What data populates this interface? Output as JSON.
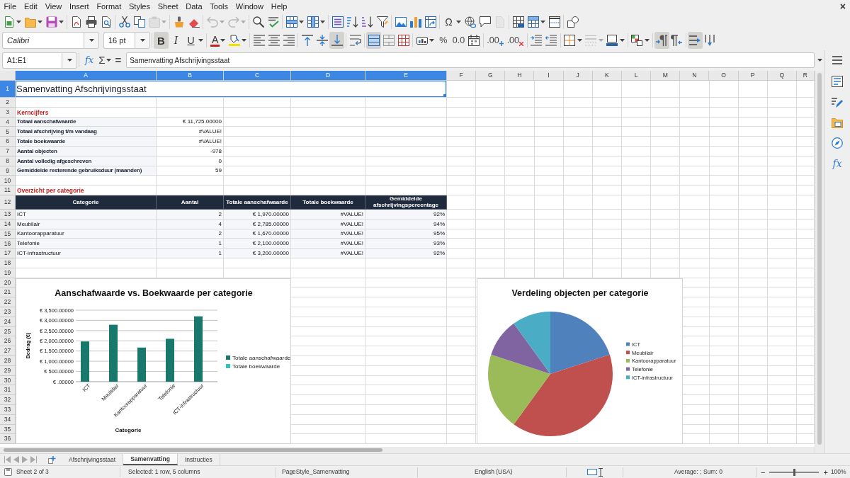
{
  "menu_bar": {
    "items": [
      "File",
      "Edit",
      "View",
      "Insert",
      "Format",
      "Styles",
      "Sheet",
      "Data",
      "Tools",
      "Window",
      "Help"
    ],
    "close": "×"
  },
  "standard_toolbar": {
    "paste_disabled": true,
    "undo_disabled": true,
    "redo_disabled": true,
    "special_character": "Ω",
    "header_footer_disabled": true
  },
  "formatting_toolbar": {
    "font_name": "Calibri",
    "font_size": "16 pt",
    "bold": {
      "glyph": "B",
      "on": true
    },
    "italic": {
      "glyph": "I",
      "on": false
    },
    "underline": {
      "glyph": "U",
      "on": false
    },
    "font_color": "A",
    "align_left": {
      "on": false
    },
    "align_center": {
      "on": false
    },
    "align_right": {
      "on": false
    },
    "align_top": {
      "on": false
    },
    "align_middle": {
      "on": false
    },
    "align_bottom": {
      "on": true
    },
    "wrap_text": {
      "on": false
    },
    "merge_and_center": {
      "on": true
    },
    "percent": "%",
    "standard_format": "0.0",
    "add_decimal": ".00",
    "delete_decimal": ".00",
    "line_style_disabled": true,
    "left_to_right": {
      "on": true
    },
    "right_to_left": {
      "on": false
    },
    "text_direction_horizontal": {
      "on": true
    },
    "text_direction_vertical": {
      "on": false
    }
  },
  "formula_bar": {
    "name_box": "A1:E1",
    "function_wizard": "fx",
    "sum": "Σ",
    "formula": "=",
    "content": "Samenvatting Afschrijvingsstaat"
  },
  "sidebar": {
    "functions": "fx"
  },
  "sheet": {
    "columns": [
      {
        "label": "A",
        "selected": true
      },
      {
        "label": "B",
        "selected": true
      },
      {
        "label": "C",
        "selected": true
      },
      {
        "label": "D",
        "selected": true
      },
      {
        "label": "E",
        "selected": true
      },
      {
        "label": "F",
        "selected": false
      },
      {
        "label": "G",
        "selected": false
      },
      {
        "label": "H",
        "selected": false
      },
      {
        "label": "I",
        "selected": false
      },
      {
        "label": "J",
        "selected": false
      },
      {
        "label": "K",
        "selected": false
      },
      {
        "label": "L",
        "selected": false
      },
      {
        "label": "M",
        "selected": false
      },
      {
        "label": "N",
        "selected": false
      },
      {
        "label": "O",
        "selected": false
      },
      {
        "label": "P",
        "selected": false
      },
      {
        "label": "Q",
        "selected": false
      },
      {
        "label": "R",
        "selected": false
      }
    ],
    "rows": [
      {
        "number": "1",
        "selected": true,
        "kind": "title",
        "cells": [
          "Samenvatting Afschrijvingsstaat"
        ]
      },
      {
        "number": "2",
        "selected": false,
        "kind": "empty"
      },
      {
        "number": "3",
        "selected": false,
        "kind": "section",
        "cells": [
          "Kerncijfers"
        ]
      },
      {
        "number": "4",
        "selected": false,
        "kind": "metric",
        "cells": [
          "Totaal aanschafwaarde",
          "€ 11,725.00000"
        ]
      },
      {
        "number": "5",
        "selected": false,
        "kind": "metric",
        "cells": [
          "Totaal afschrijving t/m vandaag",
          "#VALUE!"
        ]
      },
      {
        "number": "6",
        "selected": false,
        "kind": "metric",
        "cells": [
          "Totale boekwaarde",
          "#VALUE!"
        ]
      },
      {
        "number": "7",
        "selected": false,
        "kind": "metric",
        "cells": [
          "Aantal objecten",
          "-978"
        ]
      },
      {
        "number": "8",
        "selected": false,
        "kind": "metric",
        "cells": [
          "Aantal volledig afgeschreven",
          "0"
        ]
      },
      {
        "number": "9",
        "selected": false,
        "kind": "metric",
        "cells": [
          "Gemiddelde resterende gebruiksduur (maanden)",
          "59"
        ]
      },
      {
        "number": "10",
        "selected": false,
        "kind": "empty"
      },
      {
        "number": "11",
        "selected": false,
        "kind": "section",
        "cells": [
          "Overzicht per categorie"
        ]
      },
      {
        "number": "12",
        "selected": false,
        "kind": "header",
        "cells": [
          "Categorie",
          "Aantal",
          "Totale aanschafwaarde",
          "Totale boekwaarde",
          "Gemiddelde afschrijvingspercentage"
        ]
      },
      {
        "number": "13",
        "selected": false,
        "kind": "data",
        "cells": [
          "ICT",
          "2",
          "€ 1,970.00000",
          "#VALUE!",
          "92%"
        ]
      },
      {
        "number": "14",
        "selected": false,
        "kind": "data",
        "cells": [
          "Meubilair",
          "4",
          "€ 2,785.00000",
          "#VALUE!",
          "94%"
        ]
      },
      {
        "number": "15",
        "selected": false,
        "kind": "data",
        "cells": [
          "Kantoorapparatuur",
          "2",
          "€ 1,670.00000",
          "#VALUE!",
          "95%"
        ]
      },
      {
        "number": "16",
        "selected": false,
        "kind": "data",
        "cells": [
          "Telefonie",
          "1",
          "€ 2,100.00000",
          "#VALUE!",
          "93%"
        ]
      },
      {
        "number": "17",
        "selected": false,
        "kind": "data",
        "cells": [
          "ICT-infrastructuur",
          "1",
          "€ 3,200.00000",
          "#VALUE!",
          "92%"
        ]
      },
      {
        "number": "18",
        "selected": false,
        "kind": "empty"
      },
      {
        "number": "19",
        "selected": false,
        "kind": "empty"
      },
      {
        "number": "20",
        "selected": false,
        "kind": "empty"
      },
      {
        "number": "21",
        "selected": false,
        "kind": "empty"
      },
      {
        "number": "22",
        "selected": false,
        "kind": "empty"
      },
      {
        "number": "23",
        "selected": false,
        "kind": "empty"
      },
      {
        "number": "24",
        "selected": false,
        "kind": "empty"
      },
      {
        "number": "25",
        "selected": false,
        "kind": "empty"
      },
      {
        "number": "26",
        "selected": false,
        "kind": "empty"
      },
      {
        "number": "27",
        "selected": false,
        "kind": "empty"
      },
      {
        "number": "28",
        "selected": false,
        "kind": "empty"
      },
      {
        "number": "29",
        "selected": false,
        "kind": "empty"
      },
      {
        "number": "30",
        "selected": false,
        "kind": "empty"
      },
      {
        "number": "31",
        "selected": false,
        "kind": "empty"
      },
      {
        "number": "32",
        "selected": false,
        "kind": "empty"
      },
      {
        "number": "33",
        "selected": false,
        "kind": "empty"
      },
      {
        "number": "34",
        "selected": false,
        "kind": "empty"
      },
      {
        "number": "35",
        "selected": false,
        "kind": "empty"
      },
      {
        "number": "36",
        "selected": false,
        "kind": "empty"
      }
    ]
  },
  "charts": [
    {
      "chart_data": {
        "type": "bar",
        "title": "Aanschafwaarde vs. Boekwaarde per categorie",
        "xlabel": "Categorie",
        "ylabel": "Bedrag (€)",
        "categories": [
          "ICT",
          "Meubilair",
          "Kantoorapparatuur",
          "Telefonie",
          "ICT-infrastructuur"
        ],
        "series": [
          {
            "name": "Totale aanschafwaarde",
            "color": "#17786b",
            "values": [
              1970,
              2785,
              1670,
              2100,
              3200
            ]
          },
          {
            "name": "Totale boekwaarde",
            "color": "#35c2b2",
            "values": [
              null,
              null,
              null,
              null,
              null
            ]
          }
        ],
        "ylim": [
          0,
          3500
        ],
        "grid": true,
        "legend": "right",
        "yticks": [
          {
            "value": 0,
            "label": "€ .00000"
          },
          {
            "value": 500,
            "label": "€ 500.00000"
          },
          {
            "value": 1000,
            "label": "€ 1,000.00000"
          },
          {
            "value": 1500,
            "label": "€ 1,500.00000"
          },
          {
            "value": 2000,
            "label": "€ 2,000.00000"
          },
          {
            "value": 2500,
            "label": "€ 2,500.00000"
          },
          {
            "value": 3000,
            "label": "€ 3,000.00000"
          },
          {
            "value": 3500,
            "label": "€ 3,500.00000"
          }
        ]
      }
    },
    {
      "chart_data": {
        "type": "pie",
        "title": "Verdeling objecten per categorie",
        "categories": [
          "ICT",
          "Meubilair",
          "Kantoorapparatuur",
          "Telefonie",
          "ICT-infrastructuur"
        ],
        "values": [
          20,
          40,
          20,
          10,
          10
        ],
        "colors": [
          "#4f81bd",
          "#c0504d",
          "#9bbb59",
          "#8064a2",
          "#4bacc6"
        ],
        "legend": "right"
      }
    }
  ],
  "sheet_tabs": [
    {
      "label": "Afschrijvingsstaat",
      "selected": false
    },
    {
      "label": "Samenvatting",
      "selected": true
    },
    {
      "label": "Instructies",
      "selected": false
    }
  ],
  "status_bar": {
    "sheet": "Sheet 2 of 3",
    "selection": "Selected: 1 row, 5 columns",
    "page_style": "PageStyle_Samenvatting",
    "language": "English (USA)",
    "summary": "Average: ; Sum: 0",
    "zoom_out": "−",
    "zoom": {
      "level": 0.5
    },
    "zoom_in": "+",
    "zoom_percent": "100%"
  }
}
